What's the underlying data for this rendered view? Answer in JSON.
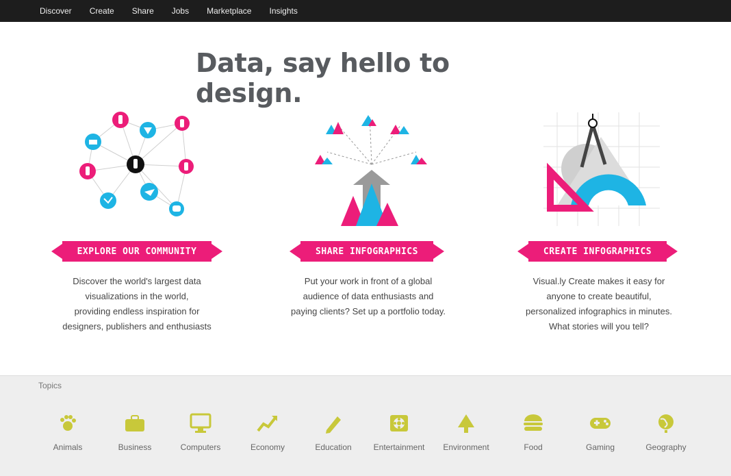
{
  "topnav": {
    "items": [
      "Discover",
      "Create",
      "Share",
      "Jobs",
      "Marketplace",
      "Insights"
    ]
  },
  "hero": {
    "title": "Data, say hello to design."
  },
  "columns": [
    {
      "button": "EXPLORE OUR COMMUNITY",
      "lines": [
        "Discover the world's largest data",
        "visualizations in the world,",
        "providing endless inspiration for",
        "designers, publishers and enthusiasts"
      ]
    },
    {
      "button": "SHARE INFOGRAPHICS",
      "lines": [
        "Put your work in front of a global",
        "audience of data enthusiasts and",
        "paying clients? Set up a portfolio today."
      ]
    },
    {
      "button": "CREATE INFOGRAPHICS",
      "lines": [
        "Visual.ly Create makes it easy for",
        "anyone to create beautiful,",
        "personalized infographics in minutes.",
        "What stories will you tell?"
      ]
    }
  ],
  "categories": {
    "heading": "Topics",
    "items": [
      {
        "name": "Animals",
        "icon": "paw-icon"
      },
      {
        "name": "Business",
        "icon": "briefcase-icon"
      },
      {
        "name": "Computers",
        "icon": "monitor-icon"
      },
      {
        "name": "Economy",
        "icon": "chart-up-icon"
      },
      {
        "name": "Education",
        "icon": "pencil-icon"
      },
      {
        "name": "Entertainment",
        "icon": "film-reel-icon"
      },
      {
        "name": "Environment",
        "icon": "tree-icon"
      },
      {
        "name": "Food",
        "icon": "burger-icon"
      },
      {
        "name": "Gaming",
        "icon": "gamepad-icon"
      },
      {
        "name": "Geography",
        "icon": "globe-icon"
      }
    ]
  },
  "colors": {
    "accent": "#ec1d79",
    "cyan": "#1eb4e4",
    "olive": "#c8c83a"
  }
}
